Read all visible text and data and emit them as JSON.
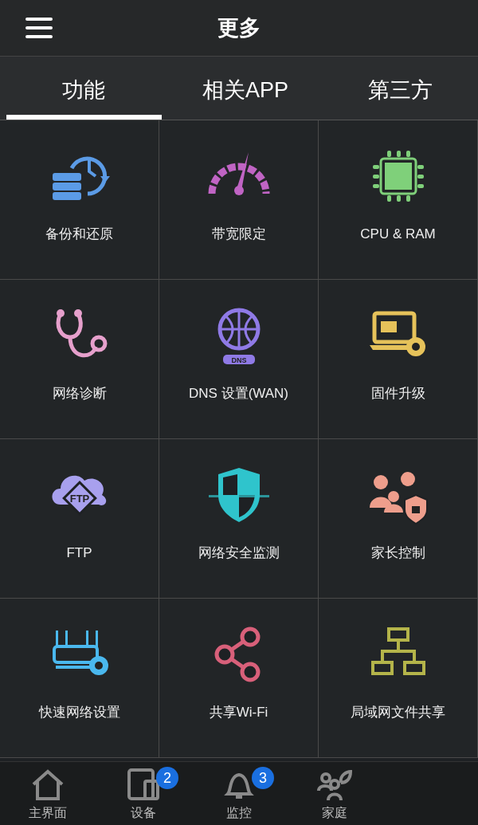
{
  "header": {
    "title": "更多"
  },
  "tabs": [
    {
      "label": "功能",
      "selected": true
    },
    {
      "label": "相关APP",
      "selected": false
    },
    {
      "label": "第三方",
      "selected": false
    }
  ],
  "features": [
    {
      "label": "备份和还原",
      "kind": "backup",
      "color": "#5b9be6"
    },
    {
      "label": "带宽限定",
      "kind": "gauge",
      "color": "#c064c4"
    },
    {
      "label": "CPU & RAM",
      "kind": "chip",
      "color": "#7fd07a"
    },
    {
      "label": "网络诊断",
      "kind": "stethoscope",
      "color": "#e6a0cc"
    },
    {
      "label": "DNS 设置(WAN)",
      "kind": "globe",
      "color": "#8f7ae6"
    },
    {
      "label": "固件升级",
      "kind": "laptop",
      "color": "#e6c25a"
    },
    {
      "label": "FTP",
      "kind": "cloud",
      "color": "#a8a0ee"
    },
    {
      "label": "网络安全监测",
      "kind": "shield",
      "color": "#2fc4cc"
    },
    {
      "label": "家长控制",
      "kind": "family",
      "color": "#ee9e8c"
    },
    {
      "label": "快速网络设置",
      "kind": "router",
      "color": "#4ab8ee"
    },
    {
      "label": "共享Wi-Fi",
      "kind": "share",
      "color": "#d8607a"
    },
    {
      "label": "局域网文件共享",
      "kind": "lan",
      "color": "#b4b44a"
    }
  ],
  "cloud_text": "FTP",
  "dns_text": "DNS",
  "nav": [
    {
      "label": "主界面",
      "kind": "home",
      "selected": false
    },
    {
      "label": "设备",
      "kind": "devices",
      "selected": false,
      "badge": "2"
    },
    {
      "label": "监控",
      "kind": "bell",
      "selected": false,
      "badge": "3"
    },
    {
      "label": "家庭",
      "kind": "family",
      "selected": false
    }
  ]
}
